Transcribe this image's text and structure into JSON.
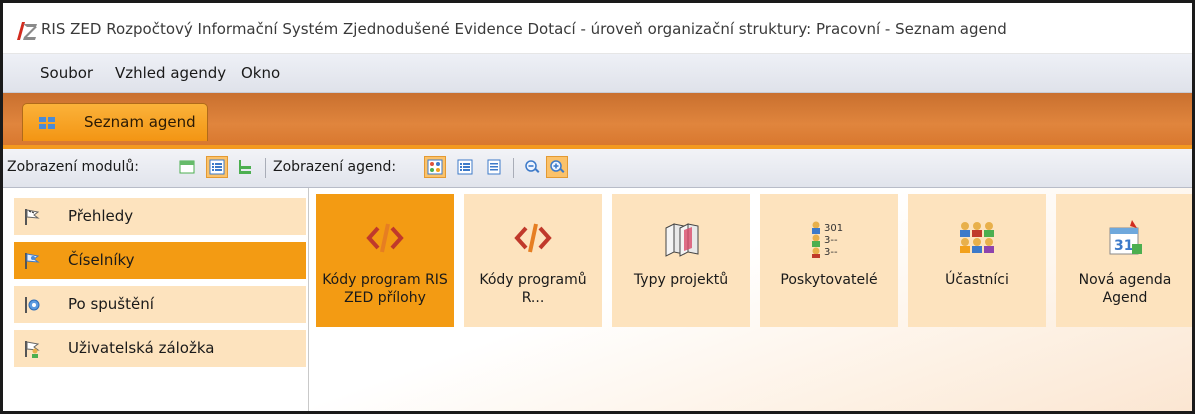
{
  "window": {
    "title": "RIS ZED Rozpočtový Informační Systém Zjednodušené Evidence Dotací - úroveň organizační struktury: Pracovní - Seznam agend"
  },
  "menu": [
    "Soubor",
    "Vzhled agendy",
    "Okno"
  ],
  "tab": {
    "label": "Seznam agend"
  },
  "toolbar": {
    "modules_label": "Zobrazení modulů:",
    "agendas_label": "Zobrazení agend:"
  },
  "sidebar": {
    "items": [
      {
        "label": "Přehledy",
        "active": false
      },
      {
        "label": "Číselníky",
        "active": true
      },
      {
        "label": "Po spuštění",
        "active": false
      },
      {
        "label": "Uživatelská záložka",
        "active": false
      }
    ]
  },
  "tiles": [
    {
      "label": "Kódy program RIS ZED přílohy",
      "icon": "code-brackets-icon",
      "active": true
    },
    {
      "label": "Kódy programů R...",
      "icon": "code-brackets-icon",
      "active": false
    },
    {
      "label": "Typy projektů",
      "icon": "books-icon",
      "active": false
    },
    {
      "label": "Poskytovatelé",
      "icon": "providers-list-icon",
      "active": false
    },
    {
      "label": "Účastníci",
      "icon": "participants-icon",
      "active": false
    },
    {
      "label": "Nová agenda Agend",
      "icon": "calendar-new-icon",
      "active": false
    }
  ],
  "colors": {
    "accent_orange": "#f39b13",
    "light_orange": "#fde3be",
    "tab_strip": "#e0853d"
  }
}
